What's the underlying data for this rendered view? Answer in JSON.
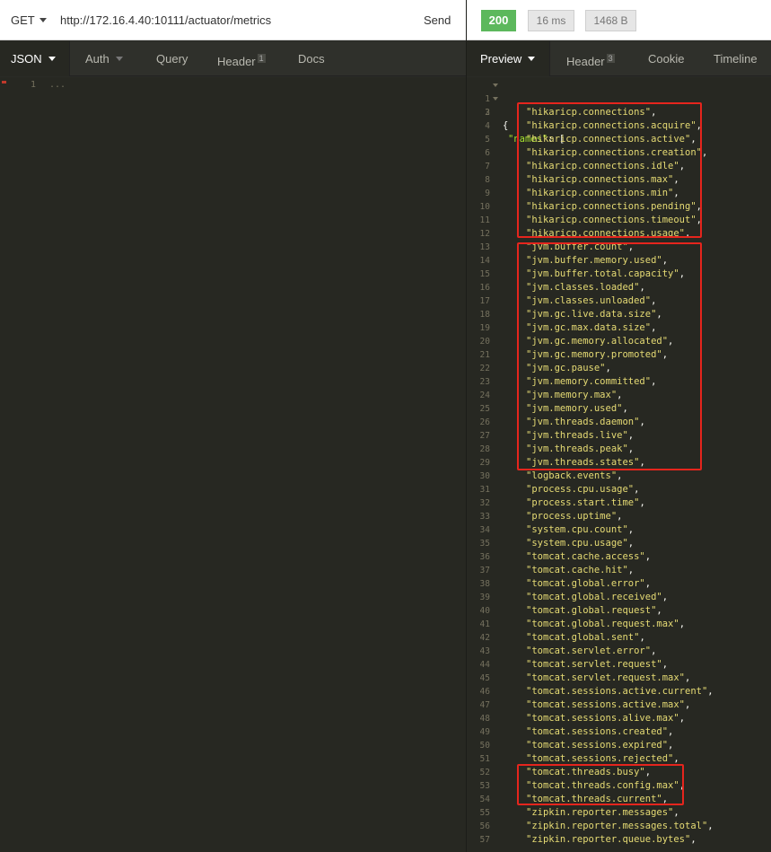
{
  "request": {
    "method": "GET",
    "url": "http://172.16.4.40:10111/actuator/metrics",
    "send_label": "Send"
  },
  "response": {
    "status": "200",
    "time": "16 ms",
    "size": "1468 B"
  },
  "left_tabs": {
    "json": "JSON",
    "auth": "Auth",
    "query": "Query",
    "header": "Header",
    "header_count": "1",
    "docs": "Docs"
  },
  "right_tabs": {
    "preview": "Preview",
    "header": "Header",
    "header_count": "3",
    "cookie": "Cookie",
    "timeline": "Timeline"
  },
  "left_editor": {
    "line_number": "1",
    "text": "..."
  },
  "preview": {
    "open_brace": "{",
    "key": "\"names\"",
    "key_suffix": ": [",
    "names": [
      "hikaricp.connections",
      "hikaricp.connections.acquire",
      "hikaricp.connections.active",
      "hikaricp.connections.creation",
      "hikaricp.connections.idle",
      "hikaricp.connections.max",
      "hikaricp.connections.min",
      "hikaricp.connections.pending",
      "hikaricp.connections.timeout",
      "hikaricp.connections.usage",
      "jvm.buffer.count",
      "jvm.buffer.memory.used",
      "jvm.buffer.total.capacity",
      "jvm.classes.loaded",
      "jvm.classes.unloaded",
      "jvm.gc.live.data.size",
      "jvm.gc.max.data.size",
      "jvm.gc.memory.allocated",
      "jvm.gc.memory.promoted",
      "jvm.gc.pause",
      "jvm.memory.committed",
      "jvm.memory.max",
      "jvm.memory.used",
      "jvm.threads.daemon",
      "jvm.threads.live",
      "jvm.threads.peak",
      "jvm.threads.states",
      "logback.events",
      "process.cpu.usage",
      "process.start.time",
      "process.uptime",
      "system.cpu.count",
      "system.cpu.usage",
      "tomcat.cache.access",
      "tomcat.cache.hit",
      "tomcat.global.error",
      "tomcat.global.received",
      "tomcat.global.request",
      "tomcat.global.request.max",
      "tomcat.global.sent",
      "tomcat.servlet.error",
      "tomcat.servlet.request",
      "tomcat.servlet.request.max",
      "tomcat.sessions.active.current",
      "tomcat.sessions.active.max",
      "tomcat.sessions.alive.max",
      "tomcat.sessions.created",
      "tomcat.sessions.expired",
      "tomcat.sessions.rejected",
      "tomcat.threads.busy",
      "tomcat.threads.config.max",
      "tomcat.threads.current",
      "zipkin.reporter.messages",
      "zipkin.reporter.messages.total",
      "zipkin.reporter.queue.bytes"
    ]
  },
  "colors": {
    "status_ok": "#5cb85c",
    "highlight_box": "#e5251d",
    "string": "#e6db74",
    "key": "#a6e22e",
    "editor_bg": "#272822"
  }
}
